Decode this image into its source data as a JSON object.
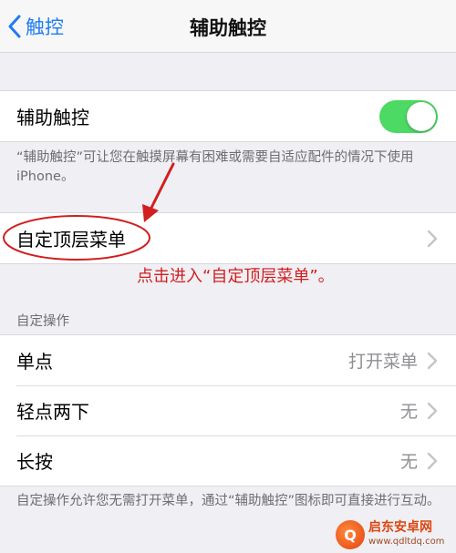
{
  "nav": {
    "back_label": "触控",
    "title": "辅助触控"
  },
  "assistive_touch": {
    "label": "辅助触控",
    "toggle_on": true,
    "footnote": "“辅助触控”可让您在触摸屏幕有困难或需要自适应配件的情况下使用iPhone。"
  },
  "customize_menu": {
    "label": "自定顶层菜单"
  },
  "annotation": {
    "text": "点击进入“自定顶层菜单”。",
    "color": "#d21e1e"
  },
  "custom_actions": {
    "header": "自定操作",
    "rows": [
      {
        "label": "单点",
        "value": "打开菜单"
      },
      {
        "label": "轻点两下",
        "value": "无"
      },
      {
        "label": "长按",
        "value": "无"
      }
    ],
    "footnote": "自定操作允许您无需打开菜单，通过“辅助触控”图标即可直接进行互动。"
  },
  "watermark": {
    "name": "启东安卓网",
    "url": "www.qdltdq.com"
  },
  "colors": {
    "accent": "#1f7cf2",
    "toggle_on": "#4cd964",
    "background": "#efeff4"
  }
}
